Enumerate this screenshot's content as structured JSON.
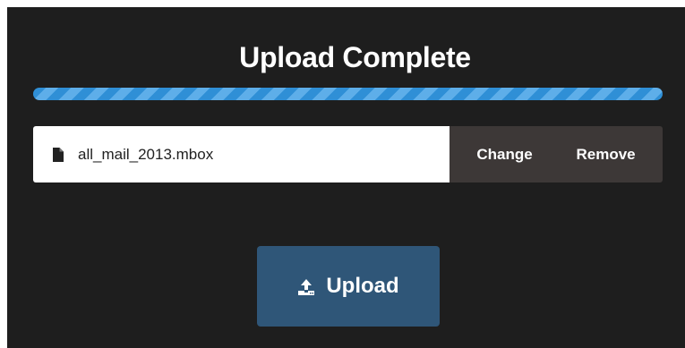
{
  "upload": {
    "title": "Upload Complete",
    "progress": 1.0,
    "file_name": "all_mail_2013.mbox",
    "change_label": "Change",
    "remove_label": "Remove",
    "upload_label": "Upload"
  },
  "colors": {
    "panel_background": "#1e1e1e",
    "progress_bar": "#2f8fd6",
    "progress_stripe": "#5eaee9",
    "file_actions_background": "#3d3837",
    "upload_button": "#2f5678"
  },
  "icons": {
    "file": "file-icon",
    "upload": "upload-icon"
  }
}
